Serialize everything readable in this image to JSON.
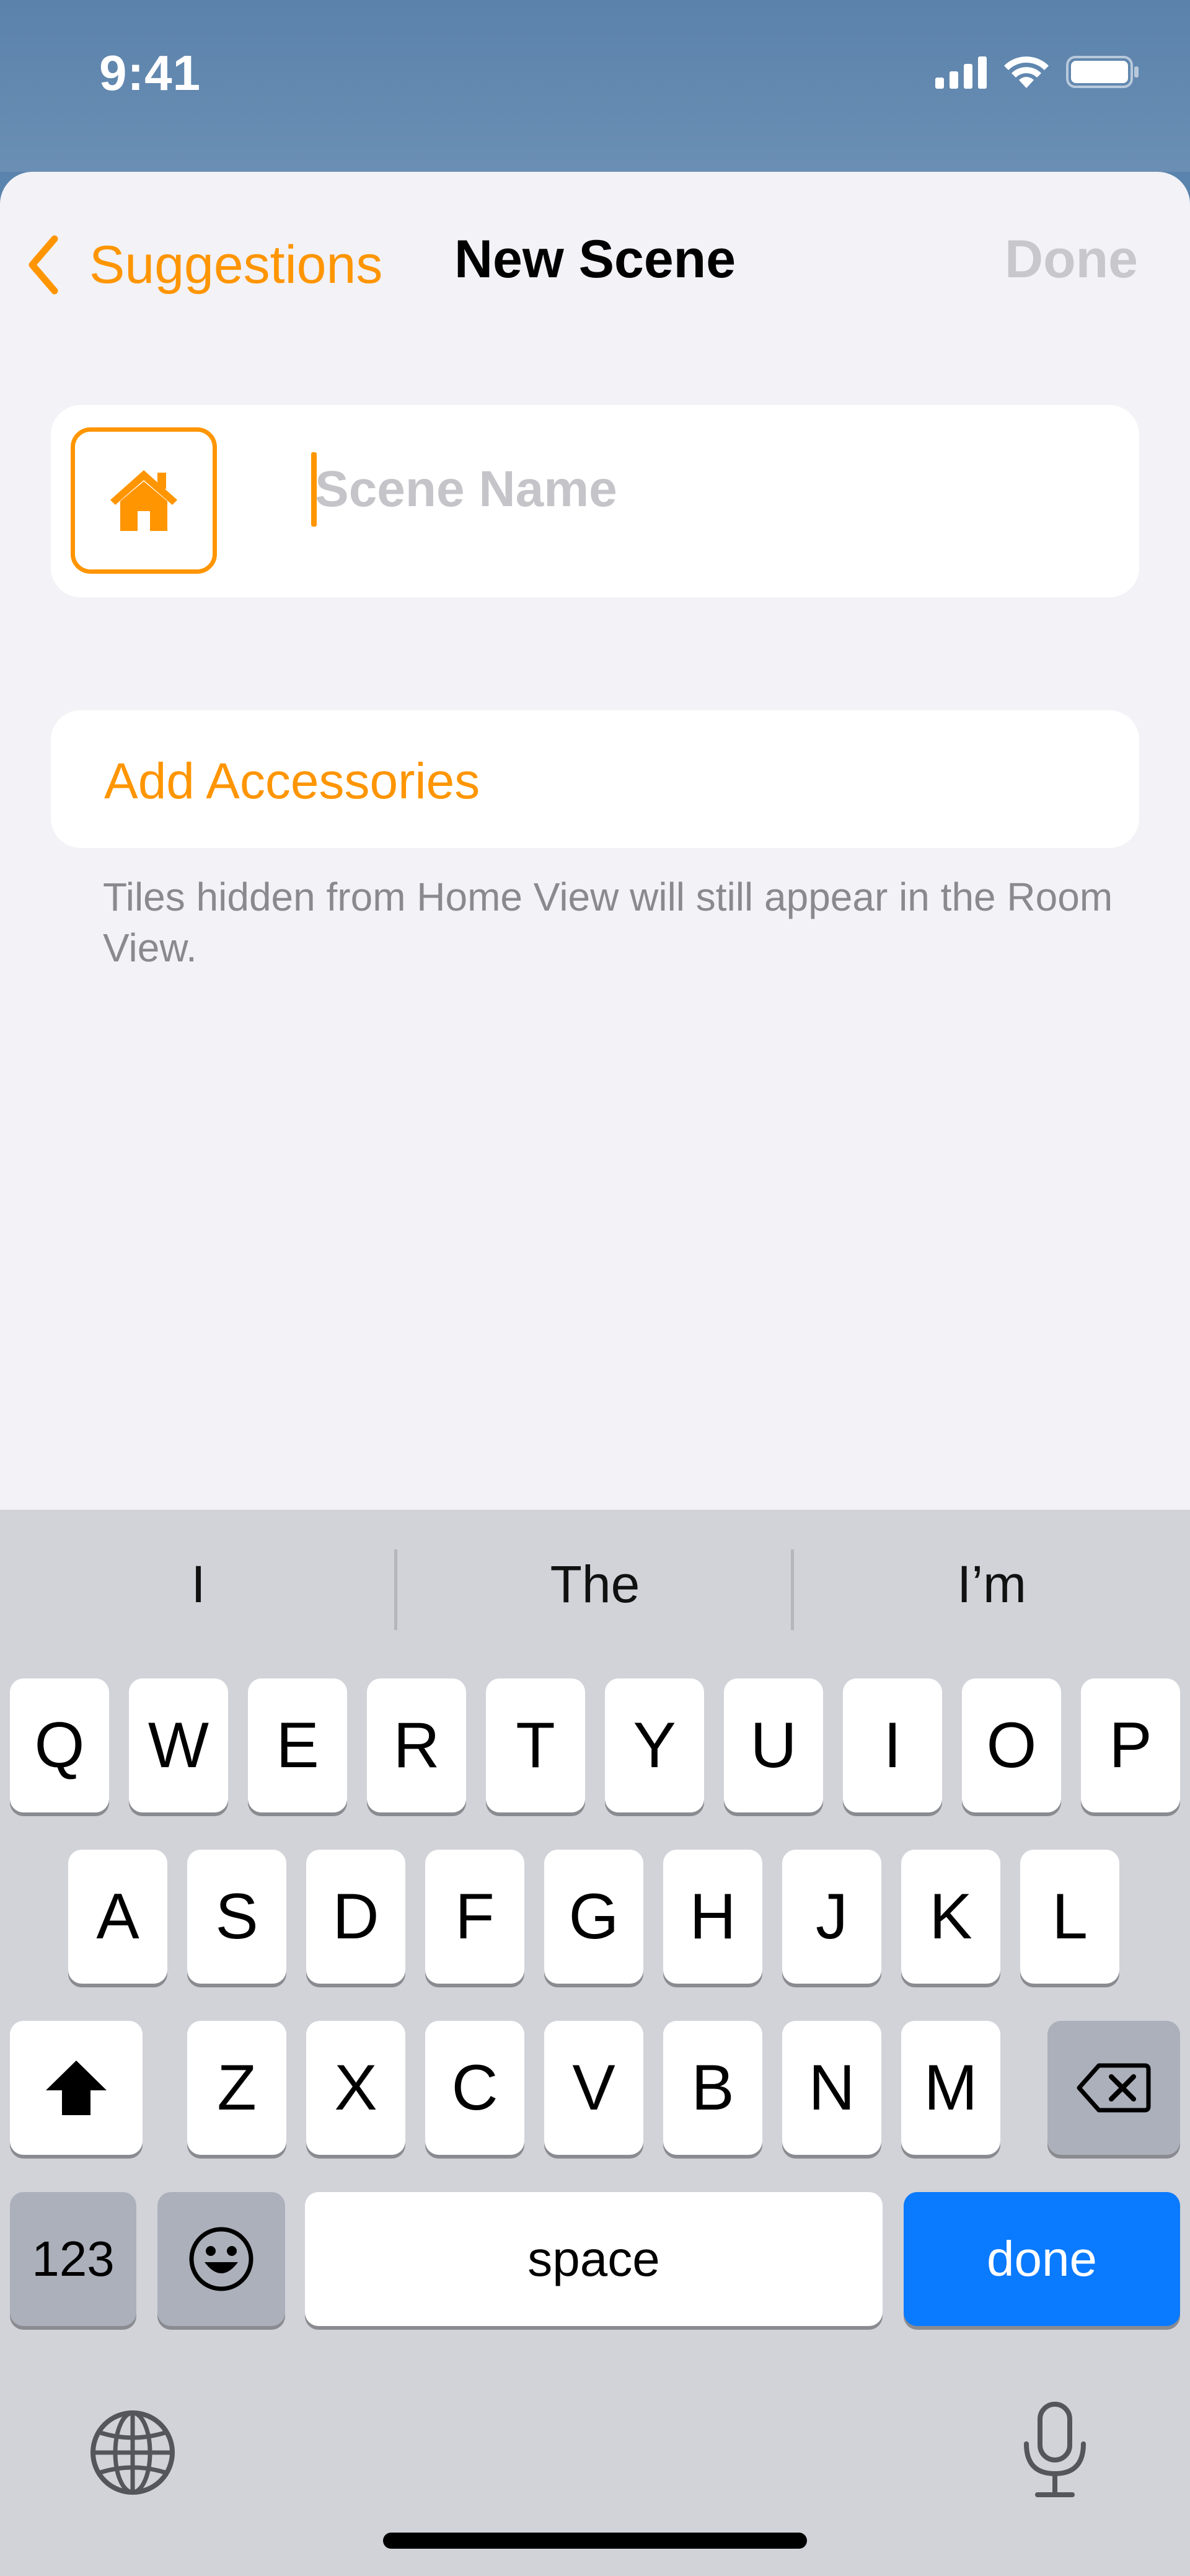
{
  "status_bar": {
    "time": "9:41",
    "icons": [
      "cellular-signal-icon",
      "wifi-icon",
      "battery-icon"
    ]
  },
  "nav": {
    "back_label": "Suggestions",
    "title": "New Scene",
    "done_label": "Done"
  },
  "scene_name": {
    "placeholder": "Scene Name",
    "value": "",
    "icon": "house-icon"
  },
  "accessories": {
    "label": "Add Accessories",
    "footnote": "Tiles hidden from Home View will still appear in the Room View."
  },
  "keyboard": {
    "suggestions": [
      "I",
      "The",
      "I’m"
    ],
    "row1": [
      "Q",
      "W",
      "E",
      "R",
      "T",
      "Y",
      "U",
      "I",
      "O",
      "P"
    ],
    "row2": [
      "A",
      "S",
      "D",
      "F",
      "G",
      "H",
      "J",
      "K",
      "L"
    ],
    "row3": [
      "Z",
      "X",
      "C",
      "V",
      "B",
      "N",
      "M"
    ],
    "numbers_label": "123",
    "space_label": "space",
    "done_label": "done"
  },
  "colors": {
    "accent": "#ff9500",
    "keyboard_done": "#0a7aff",
    "background": "#f2f2f7"
  }
}
